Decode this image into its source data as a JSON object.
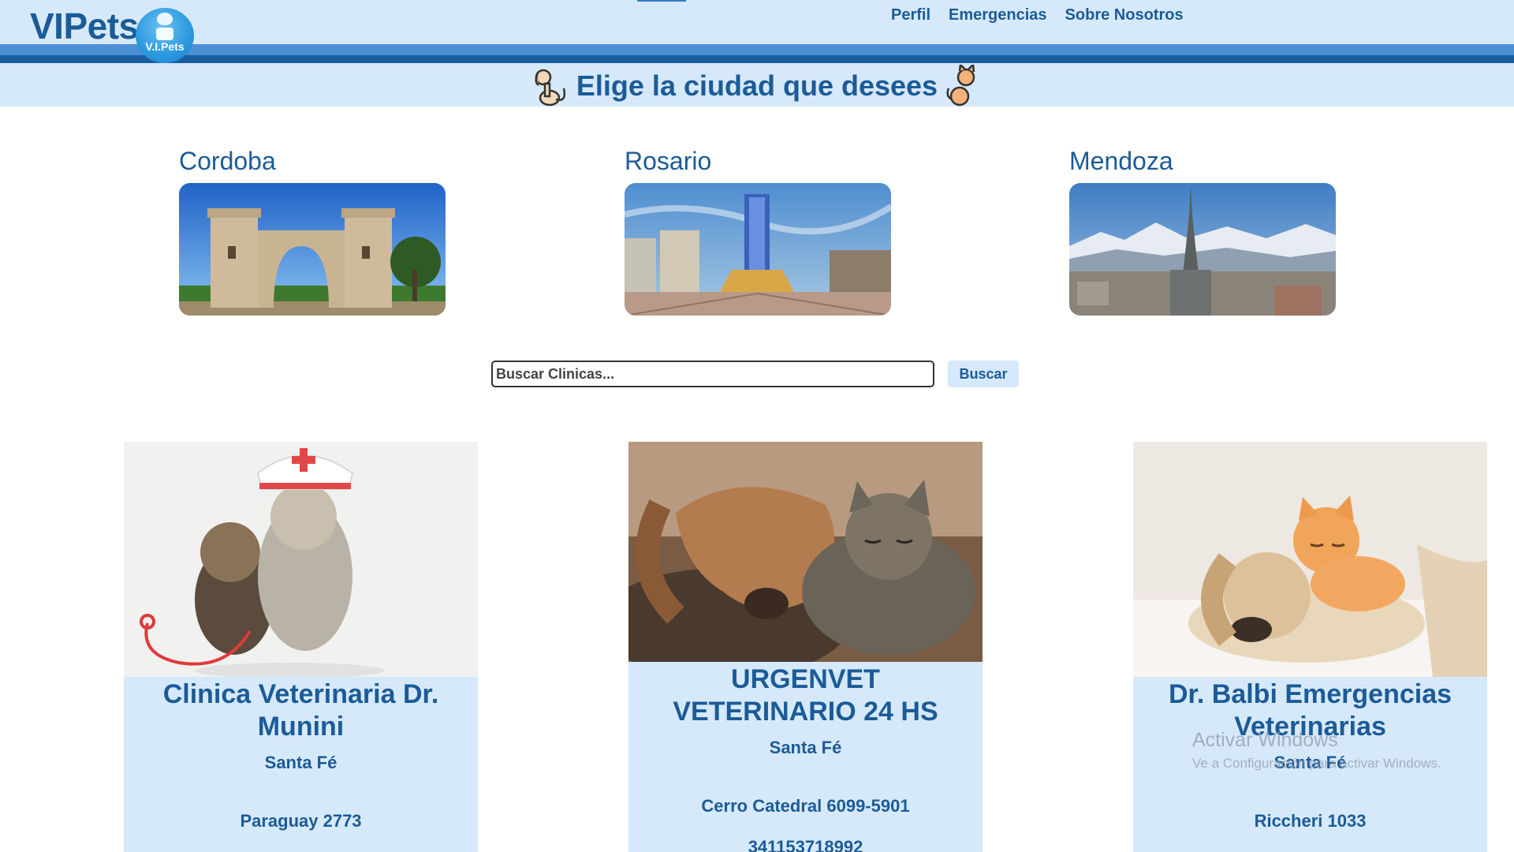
{
  "header": {
    "brand": "VIPets",
    "logo_text": "V.I.Pets",
    "nav": [
      "Perfil",
      "Emergencias",
      "Sobre Nosotros"
    ]
  },
  "subheader": {
    "title": "Elige la ciudad que desees",
    "left_icon": "dog-icon",
    "right_icon": "cat-icon"
  },
  "cities": [
    {
      "name": "Cordoba",
      "image": "cordoba-arch-photo"
    },
    {
      "name": "Rosario",
      "image": "rosario-monument-photo"
    },
    {
      "name": "Mendoza",
      "image": "mendoza-mountains-photo"
    }
  ],
  "search": {
    "placeholder": "Buscar Clinicas...",
    "button": "Buscar"
  },
  "clinics": [
    {
      "name": "Clinica Veterinaria Dr. Munini",
      "city": "Santa Fé",
      "address": "Paraguay 2773",
      "phone": ""
    },
    {
      "name": "URGENVET VETERINARIO 24 HS",
      "city": "Santa Fé",
      "address": "Cerro Catedral 6099-5901",
      "phone": "341153718992"
    },
    {
      "name": "Dr. Balbi Emergencias Veterinarias",
      "city": "Santa Fé",
      "address": "Riccheri 1033",
      "phone": ""
    }
  ],
  "watermark": {
    "title": "Activar Windows",
    "subtitle": "Ve a Configuración para activar Windows."
  },
  "colors": {
    "primary": "#1b5b97",
    "light_bg": "#d6e9fb",
    "band_light": "#4b8fd6",
    "band_dark": "#1a5c9e"
  }
}
